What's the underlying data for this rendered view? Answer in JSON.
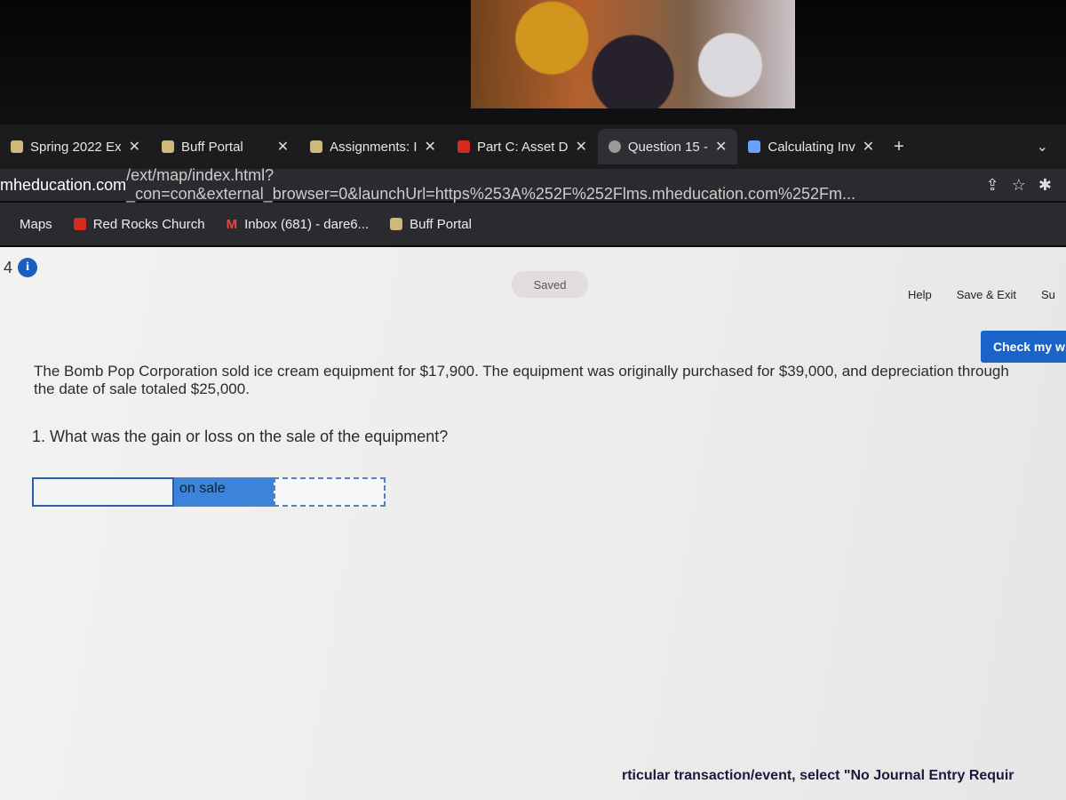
{
  "tabs": [
    {
      "label": "Spring 2022 Ex",
      "favicon": "cu-logo-icon"
    },
    {
      "label": "Buff Portal",
      "favicon": "cu-logo-icon"
    },
    {
      "label": "Assignments: I",
      "favicon": "cu-logo-icon"
    },
    {
      "label": "Part C: Asset D",
      "favicon": "mcgraw-hill-icon"
    },
    {
      "label": "Question 15 -",
      "favicon": "globe-icon",
      "active": true
    },
    {
      "label": "Calculating Inv",
      "favicon": "calc-icon"
    }
  ],
  "address": {
    "host": "mheducation.com",
    "path": "/ext/map/index.html?_con=con&external_browser=0&launchUrl=https%253A%252F%252Flms.mheducation.com%252Fm..."
  },
  "bookmarks": [
    "Maps",
    "Red Rocks Church",
    "Inbox (681) - dare6...",
    "Buff Portal"
  ],
  "page": {
    "question_number": "4",
    "saved": "Saved",
    "help": "Help",
    "save_exit": "Save & Exit",
    "submit": "Su",
    "check": "Check my w",
    "problem": "The Bomb Pop Corporation sold ice cream equipment for $17,900. The equipment was originally purchased for $39,000, and depreciation through the date of sale totaled $25,000.",
    "question": "1. What was the gain or loss on the sale of the equipment?",
    "answer_label": "on sale",
    "answer_select": "",
    "answer_amount": "",
    "footer": "rticular transaction/event, select \"No Journal Entry Requir"
  },
  "colors": {
    "accent": "#1a63c8"
  }
}
